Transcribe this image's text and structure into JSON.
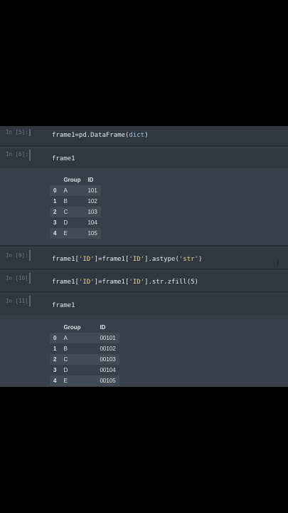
{
  "cells": [
    {
      "prompt": "In [5]:",
      "code_prefix": "frame1=pd.DataFrame(",
      "code_arg": "dict",
      "code_suffix": ")"
    },
    {
      "prompt": "In [6]:",
      "code": "frame1"
    },
    {
      "prompt": "In [9]:",
      "code_a": "frame1[",
      "code_b": "'ID'",
      "code_c": "]=frame1[",
      "code_d": "'ID'",
      "code_e": "].astype(",
      "code_f": "'str'",
      "code_g": ")"
    },
    {
      "prompt": "In [10]:",
      "code_a": "frame1[",
      "code_b": "'ID'",
      "code_c": "]=frame1[",
      "code_d": "'ID'",
      "code_e": "].str.zfill(5)"
    },
    {
      "prompt": "In [11]:",
      "code": "frame1"
    }
  ],
  "table1": {
    "headers": [
      "Group",
      "ID"
    ],
    "rows": [
      {
        "idx": "0",
        "group": "A",
        "id": "101"
      },
      {
        "idx": "1",
        "group": "B",
        "id": "102"
      },
      {
        "idx": "2",
        "group": "C",
        "id": "103"
      },
      {
        "idx": "3",
        "group": "D",
        "id": "104"
      },
      {
        "idx": "4",
        "group": "E",
        "id": "105"
      }
    ]
  },
  "table2": {
    "headers": [
      "Group",
      "ID"
    ],
    "rows": [
      {
        "idx": "0",
        "group": "A",
        "id": "00101"
      },
      {
        "idx": "1",
        "group": "B",
        "id": "00102"
      },
      {
        "idx": "2",
        "group": "C",
        "id": "00103"
      },
      {
        "idx": "3",
        "group": "D",
        "id": "00104"
      },
      {
        "idx": "4",
        "group": "E",
        "id": "00105"
      }
    ]
  },
  "cursor_icon": "text-cursor-icon"
}
